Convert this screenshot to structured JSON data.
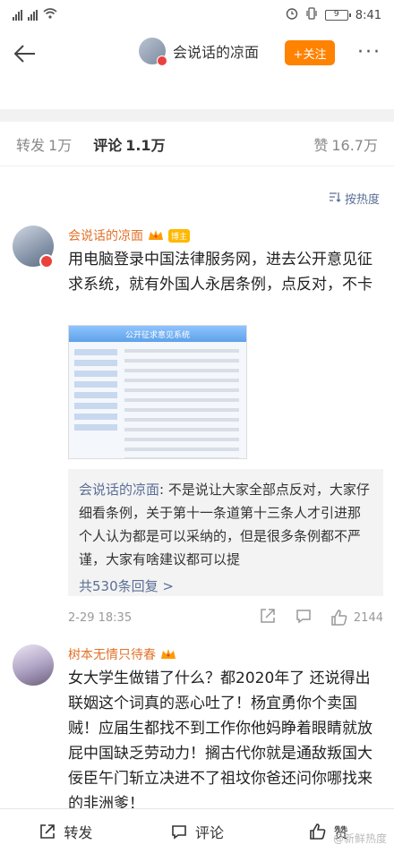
{
  "status": {
    "time": "8:41",
    "battery": "9"
  },
  "nav": {
    "title": "会说话的凉面",
    "follow": "+关注"
  },
  "tabs": {
    "repost_label": "转发",
    "repost_count": "1万",
    "comment_label": "评论",
    "comment_count": "1.1万",
    "like_label": "赞",
    "like_count": "16.7万"
  },
  "sort": "按热度",
  "comments": [
    {
      "name": "会说话的凉面",
      "tag": "博主",
      "text": "用电脑登录中国法律服务网，进去公开意见征求系统，就有外国人永居条例，点反对，不卡",
      "image_title": "公开征求意见系统",
      "reply": {
        "name": "会说话的凉面",
        "text": "不是说让大家全部点反对，大家仔细看条例，关于第十一条道第十三条人才引进那个人认为都是可以采纳的，但是很多条例都不严谨，大家有啥建议都可以提",
        "more": "共530条回复 >"
      },
      "time": "2-29 18:35",
      "likes": "2144"
    },
    {
      "name": "树本无情只待春",
      "text": "女大学生做错了什么？都2020年了 还说得出联姻这个词真的恶心吐了！杨宜勇你个卖国贼！应届生都找不到工作你他妈睁着眼睛就放屁中国缺乏劳动力！搁古代你就是通敌叛国大佞臣午门斩立决进不了祖坟你爸还问你哪找来的非洲爹！"
    }
  ],
  "bottom": {
    "repost": "转发",
    "comment": "评论",
    "like": "赞"
  },
  "watermark": "@新鲜热度"
}
